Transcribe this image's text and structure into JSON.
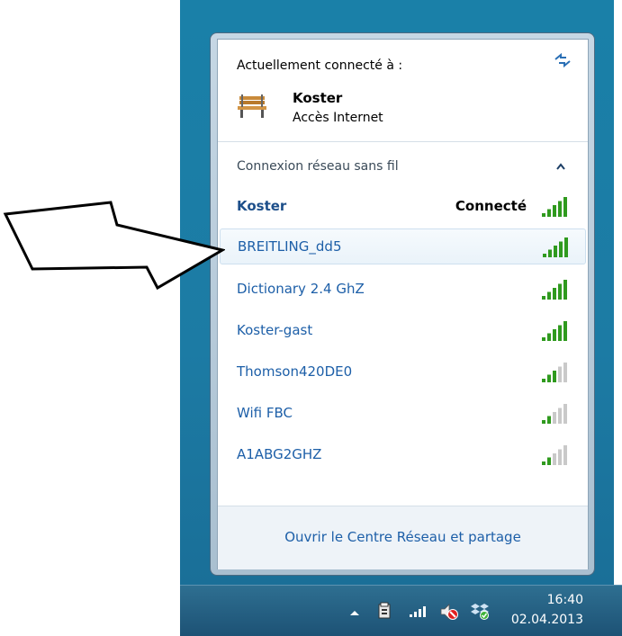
{
  "current": {
    "label": "Actuellement connecté à :",
    "network": "Koster",
    "status": "Accès Internet"
  },
  "group": {
    "label": "Connexion réseau sans fil"
  },
  "networks": [
    {
      "name": "Koster",
      "status": "Connecté",
      "signal_bars": 5
    },
    {
      "name": "BREITLING_dd5",
      "status": "",
      "signal_bars": 5
    },
    {
      "name": "Dictionary 2.4 GhZ",
      "status": "",
      "signal_bars": 5
    },
    {
      "name": "Koster-gast",
      "status": "",
      "signal_bars": 5
    },
    {
      "name": "Thomson420DE0",
      "status": "",
      "signal_bars": 3
    },
    {
      "name": "Wifi FBC",
      "status": "",
      "signal_bars": 2
    },
    {
      "name": "A1ABG2GHZ",
      "status": "",
      "signal_bars": 2
    }
  ],
  "footer": {
    "link": "Ouvrir le Centre Réseau et partage"
  },
  "taskbar": {
    "time": "16:40",
    "date": "02.04.2013"
  },
  "icons": {
    "refresh": "refresh-icon",
    "network_type": "bench-icon",
    "collapse": "chevron-up-icon",
    "tray": [
      "show-hidden-icons-icon",
      "action-center-icon",
      "network-icon",
      "volume-muted-icon",
      "dropbox-icon"
    ]
  },
  "colors": {
    "link": "#1d5fa8",
    "signal_active": "#2f9a1e",
    "signal_inactive": "#c9c9c9",
    "desktop": "#1f79a0"
  }
}
